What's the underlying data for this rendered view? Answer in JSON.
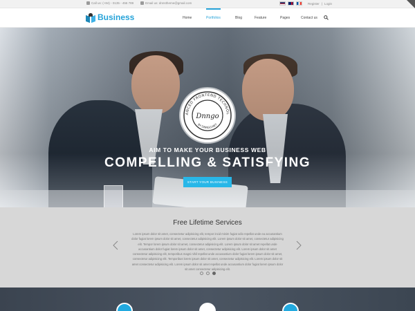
{
  "topbar": {
    "phone": "Call us: (+84) - 0135 - 456 789",
    "email": "Email us: dnnstheme@gmail.com",
    "register": "Register",
    "login": "Login",
    "separator": "|"
  },
  "header": {
    "logo_text": "Business",
    "nav": [
      "Home",
      "Portfolios",
      "Blog",
      "Feature",
      "Pages",
      "Contact us"
    ],
    "active_nav": "Portfolios"
  },
  "hero": {
    "badge_ring_text": "ADVANCED FRONTEND TECHNOLOGY",
    "badge_bottom_text": "BY DNNGO.NET",
    "badge_center": "Dnngo",
    "subtitle": "AIM TO MAKE YOUR BUSINESS WEB",
    "title": "COMPELLING & SATISFYING",
    "button_label": "START YOUR BUSINESS",
    "slide_count": 3,
    "active_slide": 1
  },
  "services": {
    "title": "Free Lifetime Services",
    "body": "Lorem ipsum dolor sit amet, consectetur adipisicing elit, tempor incid minim fugiat odio repellat unde ea accusantium dolor fugiat lorem ipsum dolor sit amet, consectetur adipisicing elit. Lorem ipsum dolor sit amet, consectetur adipisicing elit. Tempor lorem ipsum dolor sit amet, consectetur adipisicing elit. Lorem ipsum dolor sit amet repellat unde accusantium dolor fugiat lorem ipsum dolor sit amet, consectetur adipisicing elit. Lorem ipsum dolor sit amet consectetur adipisicing elit, temporibus magni nihil repellat unde accusantium dolor fugiat lorem ipsum dolor sit amet, consectetur adipisicing elit. Temporibus lorem ipsum dolor sit amet, consectetur adipisicing elit. Lorem ipsum dolor sit amet consectetur adipisicing elit. Lorem ipsum dolor sit amet repellat unde accusantium dolor fugiat lorem ipsum dolor sit amet consectetur adipisicing elit.",
    "slide_count": 3,
    "active_slide": 3
  },
  "features": {
    "icons": [
      "feature-icon-1",
      "feature-icon-2",
      "feature-icon-3"
    ]
  },
  "colors": {
    "accent": "#26a3d9",
    "button": "#28b7e8",
    "services_bg": "#d7d7d7",
    "features_bg": "#3b4450"
  }
}
